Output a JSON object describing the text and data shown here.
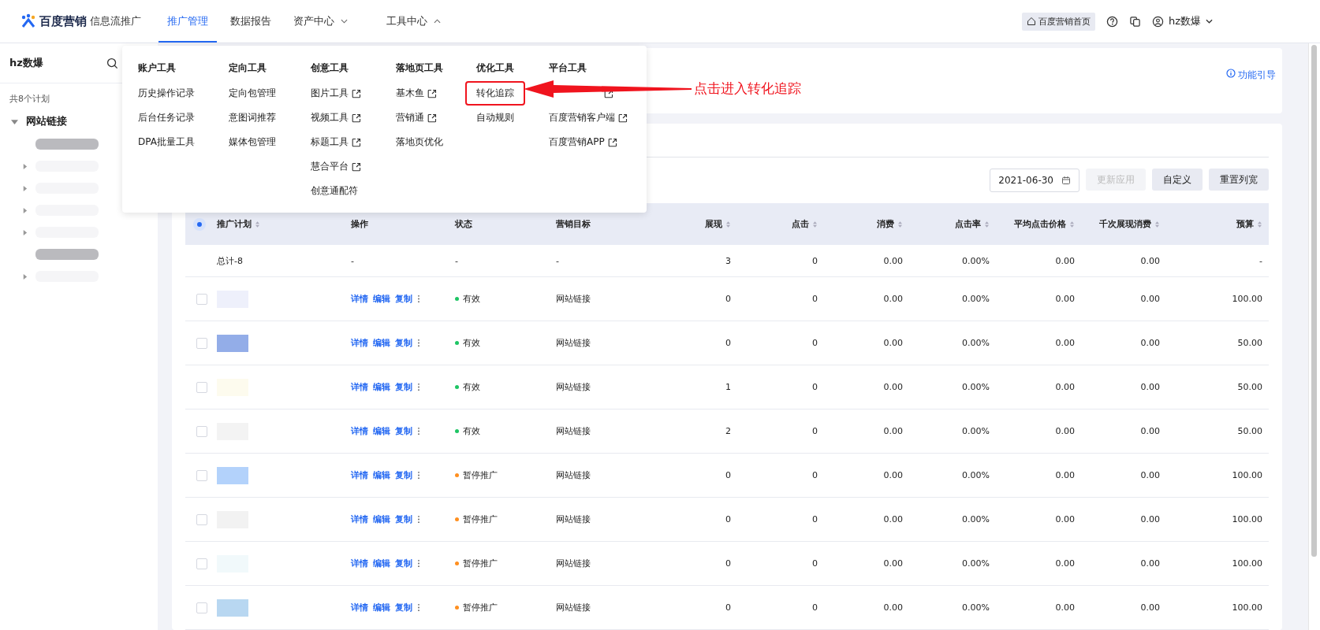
{
  "brand": {
    "logo_text": "百度营销",
    "product": "信息流推广"
  },
  "nav": [
    {
      "label": "推广管理",
      "selected": true
    },
    {
      "label": "数据报告",
      "selected": false
    },
    {
      "label": "资产中心",
      "selected": false,
      "expanded": false
    },
    {
      "label": "工具中心",
      "selected": false,
      "expanded": true
    }
  ],
  "header_right": {
    "home_button": "百度营销首页",
    "user": "hz数爆"
  },
  "sidebar": {
    "account": "hz数爆",
    "count": "共8个计划",
    "tree": [
      {
        "label": "网站链接",
        "expanded": true,
        "children": [
          {
            "kind": "leaf"
          },
          {
            "kind": "group",
            "expanded": false
          },
          {
            "kind": "group",
            "expanded": false
          },
          {
            "kind": "group",
            "expanded": false
          },
          {
            "kind": "group",
            "expanded": false
          },
          {
            "kind": "leaf"
          },
          {
            "kind": "group",
            "expanded": false
          }
        ]
      }
    ]
  },
  "tool_menu": {
    "columns": [
      {
        "title": "账户工具",
        "items": [
          {
            "label": "历史操作记录",
            "external": false,
            "highlighted": false
          },
          {
            "label": "后台任务记录",
            "external": false,
            "highlighted": false
          },
          {
            "label": "DPA批量工具",
            "external": false,
            "highlighted": false
          }
        ]
      },
      {
        "title": "定向工具",
        "items": [
          {
            "label": "定向包管理",
            "external": false,
            "highlighted": false
          },
          {
            "label": "意图词推荐",
            "external": false,
            "highlighted": false
          },
          {
            "label": "媒体包管理",
            "external": false,
            "highlighted": false
          }
        ]
      },
      {
        "title": "创意工具",
        "items": [
          {
            "label": "图片工具",
            "external": true,
            "highlighted": false
          },
          {
            "label": "视频工具",
            "external": true,
            "highlighted": false
          },
          {
            "label": "标题工具",
            "external": true,
            "highlighted": false
          },
          {
            "label": "慧合平台",
            "external": true,
            "highlighted": false
          },
          {
            "label": "创意通配符",
            "external": false,
            "highlighted": false
          }
        ]
      },
      {
        "title": "落地页工具",
        "items": [
          {
            "label": "基木鱼",
            "external": true,
            "highlighted": false
          },
          {
            "label": "营销通",
            "external": true,
            "highlighted": false
          },
          {
            "label": "落地页优化",
            "external": false,
            "highlighted": false
          }
        ]
      },
      {
        "title": "优化工具",
        "items": [
          {
            "label": "转化追踪",
            "external": false,
            "highlighted": true
          },
          {
            "label": "自动规则",
            "external": false,
            "highlighted": false
          }
        ]
      },
      {
        "title": "平台工具",
        "items": [
          {
            "external": true,
            "highlighted": false
          },
          {
            "label": "百度营销客户端",
            "external": true,
            "highlighted": false
          },
          {
            "label": "百度营销APP",
            "external": true,
            "highlighted": false
          }
        ]
      }
    ]
  },
  "annotation": {
    "text": "点击进入转化追踪"
  },
  "guide_link": "功能引导",
  "toolbar": {
    "date": "2021-06-30",
    "buttons": [
      {
        "label": "更新应用",
        "disabled": true
      },
      {
        "label": "自定义",
        "disabled": false
      },
      {
        "label": "重置列宽",
        "disabled": false
      }
    ]
  },
  "table": {
    "select_all": {
      "indeterminate": true
    },
    "columns": [
      {
        "label": "推广计划",
        "sortable": true
      },
      {
        "label": "操作",
        "sortable": false
      },
      {
        "label": "状态",
        "sortable": false
      },
      {
        "label": "营销目标",
        "sortable": false
      },
      {
        "label": "展现",
        "sortable": true
      },
      {
        "label": "点击",
        "sortable": true
      },
      {
        "label": "消费",
        "sortable": true
      },
      {
        "label": "点击率",
        "sortable": true
      },
      {
        "label": "平均点击价格",
        "sortable": true
      },
      {
        "label": "千次展现消费",
        "sortable": true
      },
      {
        "label": "预算",
        "sortable": true
      }
    ],
    "total": [
      "总计-8",
      "-",
      "-",
      "-",
      "3",
      "0",
      "0.00",
      "0.00%",
      "0.00",
      "0.00",
      "-"
    ],
    "rows": [
      {
        "checked": false,
        "actions": [
          "详情",
          "编辑",
          "复制"
        ],
        "status": "有效",
        "color": "#1ec564",
        "goal": "网站链接",
        "values": [
          "0",
          "0",
          "0.00",
          "0.00%",
          "0.00",
          "0.00",
          "100.00"
        ]
      },
      {
        "checked": false,
        "actions": [
          "详情",
          "编辑",
          "复制"
        ],
        "status": "有效",
        "color": "#1ec564",
        "goal": "网站链接",
        "values": [
          "0",
          "0",
          "0.00",
          "0.00%",
          "0.00",
          "0.00",
          "50.00"
        ]
      },
      {
        "checked": false,
        "actions": [
          "详情",
          "编辑",
          "复制"
        ],
        "status": "有效",
        "color": "#1ec564",
        "goal": "网站链接",
        "values": [
          "1",
          "0",
          "0.00",
          "0.00%",
          "0.00",
          "0.00",
          "50.00"
        ]
      },
      {
        "checked": false,
        "actions": [
          "详情",
          "编辑",
          "复制"
        ],
        "status": "有效",
        "color": "#1ec564",
        "goal": "网站链接",
        "values": [
          "2",
          "0",
          "0.00",
          "0.00%",
          "0.00",
          "0.00",
          "50.00"
        ]
      },
      {
        "checked": false,
        "actions": [
          "详情",
          "编辑",
          "复制"
        ],
        "status": "暂停推广",
        "color": "#ff8f1f",
        "goal": "网站链接",
        "values": [
          "0",
          "0",
          "0.00",
          "0.00%",
          "0.00",
          "0.00",
          "100.00"
        ]
      },
      {
        "checked": false,
        "actions": [
          "详情",
          "编辑",
          "复制"
        ],
        "status": "暂停推广",
        "color": "#ff8f1f",
        "goal": "网站链接",
        "values": [
          "0",
          "0",
          "0.00",
          "0.00%",
          "0.00",
          "0.00",
          "100.00"
        ]
      },
      {
        "checked": false,
        "actions": [
          "详情",
          "编辑",
          "复制"
        ],
        "status": "暂停推广",
        "color": "#ff8f1f",
        "goal": "网站链接",
        "values": [
          "0",
          "0",
          "0.00",
          "0.00%",
          "0.00",
          "0.00",
          "100.00"
        ]
      },
      {
        "checked": false,
        "actions": [
          "详情",
          "编辑",
          "复制"
        ],
        "status": "暂停推广",
        "color": "#ff8f1f",
        "goal": "网站链接",
        "values": [
          "0",
          "0",
          "0.00",
          "0.00%",
          "0.00",
          "0.00",
          "100.00"
        ]
      }
    ]
  }
}
